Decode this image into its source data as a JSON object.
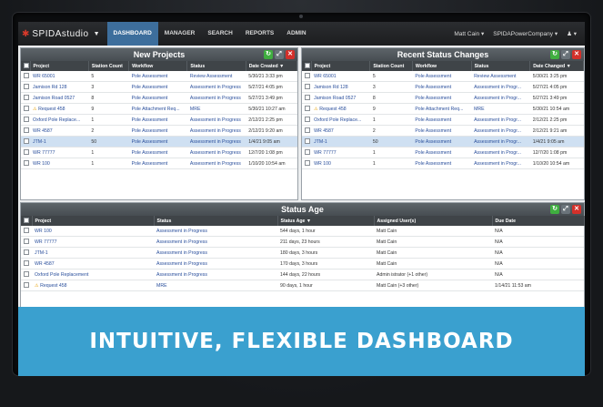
{
  "nav": {
    "logo": "SPIDAstudio",
    "items": [
      "DASHBOARD",
      "MANAGER",
      "SEARCH",
      "REPORTS",
      "ADMIN"
    ],
    "active": "DASHBOARD",
    "user": "Matt Cain",
    "company": "SPIDAPowerCompany"
  },
  "new_projects": {
    "title": "New Projects",
    "columns": [
      "Project",
      "Station Count",
      "Workflow",
      "Status",
      "Date Created"
    ],
    "rows": [
      [
        "WR 65001",
        "5",
        "Pole Assessment",
        "Review Assessment",
        "5/30/21 3:33 pm"
      ],
      [
        "Jamison Rd 128",
        "3",
        "Pole Assessment",
        "Assessment in Progress",
        "5/27/21 4:05 pm"
      ],
      [
        "Jamison Road 0527",
        "8",
        "Pole Assessment",
        "Assessment in Progress",
        "5/27/21 3:49 pm"
      ],
      [
        "Request 458",
        "9",
        "Pole Attachment Req...",
        "MRE",
        "5/30/21 10:27 am"
      ],
      [
        "Oxford Pole Replace...",
        "1",
        "Pole Assessment",
        "Assessment in Progress",
        "2/12/21 2:25 pm"
      ],
      [
        "WR 4587",
        "2",
        "Pole Assessment",
        "Assessment in Progress",
        "2/12/21 9:20 am"
      ],
      [
        "JTM-1",
        "50",
        "Pole Assessment",
        "Assessment in Progress",
        "1/4/21 9:05 am"
      ],
      [
        "WR 77777",
        "1",
        "Pole Assessment",
        "Assessment in Progress",
        "12/7/20 1:08 pm"
      ],
      [
        "WR 100",
        "1",
        "Pole Assessment",
        "Assessment in Progress",
        "1/10/20 10:54 am"
      ]
    ]
  },
  "recent_status": {
    "title": "Recent Status Changes",
    "columns": [
      "Project",
      "Station Count",
      "Workflow",
      "Status",
      "Date Changed"
    ],
    "rows": [
      [
        "WR 65001",
        "5",
        "Pole Assessment",
        "Review Assessment",
        "5/30/21 3:25 pm"
      ],
      [
        "Jamison Rd 128",
        "3",
        "Pole Assessment",
        "Assessment in Progr...",
        "5/27/21 4:05 pm"
      ],
      [
        "Jamison Road 0527",
        "8",
        "Pole Assessment",
        "Assessment in Progr...",
        "5/27/21 3:49 pm"
      ],
      [
        "Request 458",
        "9",
        "Pole Attachment Req...",
        "MRE",
        "5/30/21 10:54 am"
      ],
      [
        "Oxford Pole Replace...",
        "1",
        "Pole Assessment",
        "Assessment in Progr...",
        "2/12/21 2:25 pm"
      ],
      [
        "WR 4587",
        "2",
        "Pole Assessment",
        "Assessment in Progr...",
        "2/12/21 9:21 am"
      ],
      [
        "JTM-1",
        "50",
        "Pole Assessment",
        "Assessment in Progr...",
        "1/4/21 9:05 am"
      ],
      [
        "WR 77777",
        "1",
        "Pole Assessment",
        "Assessment in Progr...",
        "12/7/20 1:08 pm"
      ],
      [
        "WR 100",
        "1",
        "Pole Assessment",
        "Assessment in Progr...",
        "1/10/20 10:54 am"
      ]
    ]
  },
  "status_age": {
    "title": "Status Age",
    "columns": [
      "Project",
      "Status",
      "Status Age",
      "Assigned User(s)",
      "Due Date"
    ],
    "rows": [
      [
        "WR 100",
        "Assessment in Progress",
        "544 days, 1 hour",
        "Matt Cain",
        "N/A"
      ],
      [
        "WR 77777",
        "Assessment in Progress",
        "211 days, 23 hours",
        "Matt Cain",
        "N/A"
      ],
      [
        "JTM-1",
        "Assessment in Progress",
        "180 days, 3 hours",
        "Matt Cain",
        "N/A"
      ],
      [
        "WR 4587",
        "Assessment in Progress",
        "170 days, 3 hours",
        "Matt Cain",
        "N/A"
      ],
      [
        "Oxford Pole Replacement",
        "Assessment in Progress",
        "144 days, 22 hours",
        "Admin istrator (+1 other)",
        "N/A"
      ],
      [
        "Request 458",
        "MRE",
        "90 days, 1 hour",
        "Matt Cain (+3 other)",
        "1/14/21 11:53 am"
      ]
    ]
  },
  "banner": "INTUITIVE, FLEXIBLE DASHBOARD",
  "colors": {
    "nav_active": "#3d6e9c",
    "banner": "#3aa0cf",
    "header": "#474d52"
  }
}
